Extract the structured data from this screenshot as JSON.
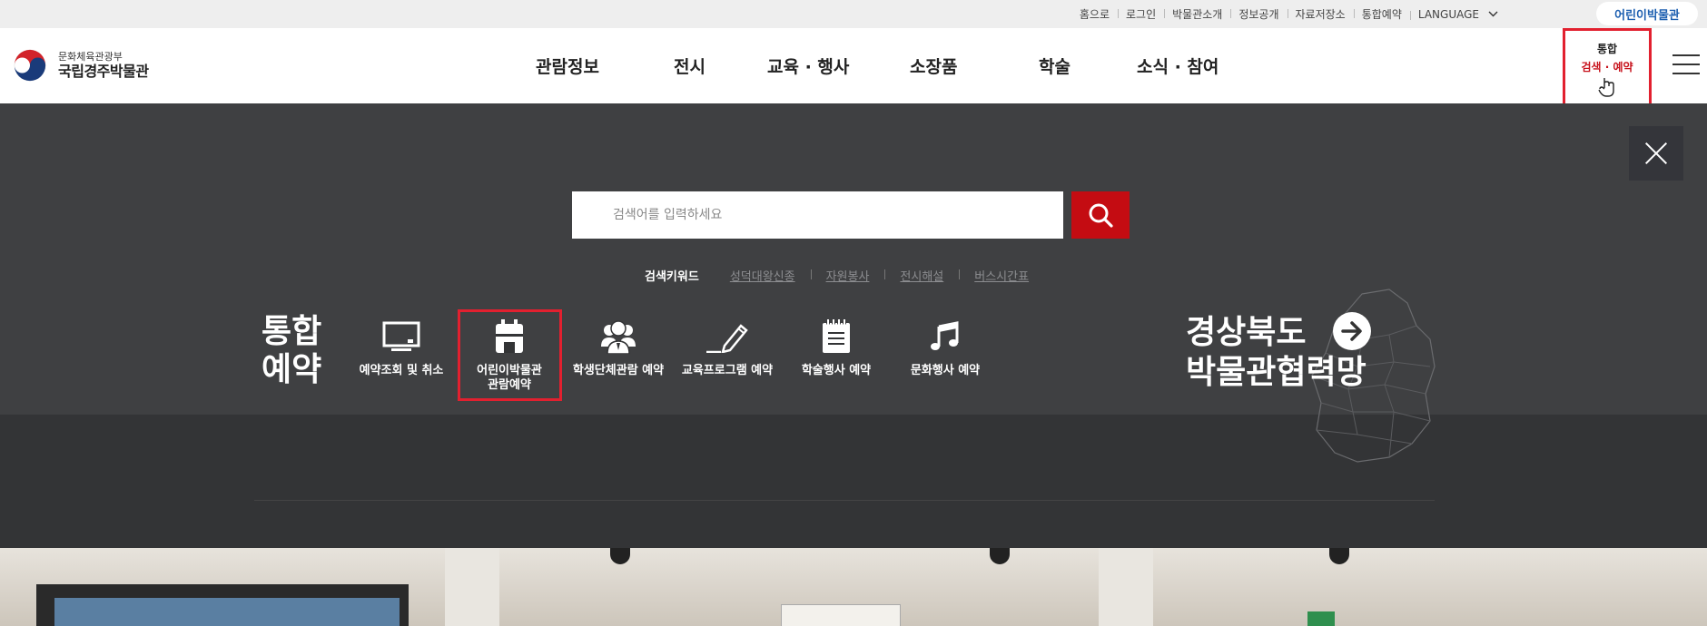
{
  "util_links": [
    "홈으로",
    "로그인",
    "박물관소개",
    "정보공개",
    "자료저장소",
    "통합예약"
  ],
  "language": {
    "label": "LANGUAGE",
    "icon": "chevron-down-icon"
  },
  "kids_museum_button": "어린이박물관",
  "logo": {
    "sub": "문화체육관광부",
    "main": "국립경주박물관",
    "icon": "taegeuk-emblem-icon"
  },
  "gnb": [
    "관람정보",
    "전시",
    "교육 · 행사",
    "소장품",
    "학술",
    "소식 · 참여"
  ],
  "unified_button": {
    "line1": "통합",
    "line2": "검색 · 예약",
    "icon": "pointer-hand-icon"
  },
  "menu_icon": "hamburger-menu-icon",
  "close_icon": "close-icon",
  "search": {
    "placeholder": "검색어를 입력하세요",
    "button_icon": "search-icon"
  },
  "keywords": {
    "title": "검색키워드",
    "items": [
      "성덕대왕신종",
      "자원봉사",
      "전시해설",
      "버스시간표"
    ]
  },
  "reservation": {
    "title_line1": "통합",
    "title_line2": "예약",
    "items": [
      {
        "label": "예약조회 및 취소",
        "icon": "monitor-icon"
      },
      {
        "label_line1": "어린이박물관",
        "label_line2": "관람예약",
        "icon": "building-calendar-icon"
      },
      {
        "label": "학생단체관람 예약",
        "icon": "group-people-icon"
      },
      {
        "label": "교육프로그램 예약",
        "icon": "pencil-icon"
      },
      {
        "label": "학술행사 예약",
        "icon": "notepad-icon"
      },
      {
        "label": "문화행사 예약",
        "icon": "music-note-icon"
      }
    ]
  },
  "network": {
    "line1": "경상북도",
    "line2": "박물관협력망",
    "icon": "arrow-right-circle-icon"
  },
  "colors": {
    "accent_red": "#c40c12",
    "highlight_red": "#e2202f",
    "overlay": "#3f4042"
  }
}
